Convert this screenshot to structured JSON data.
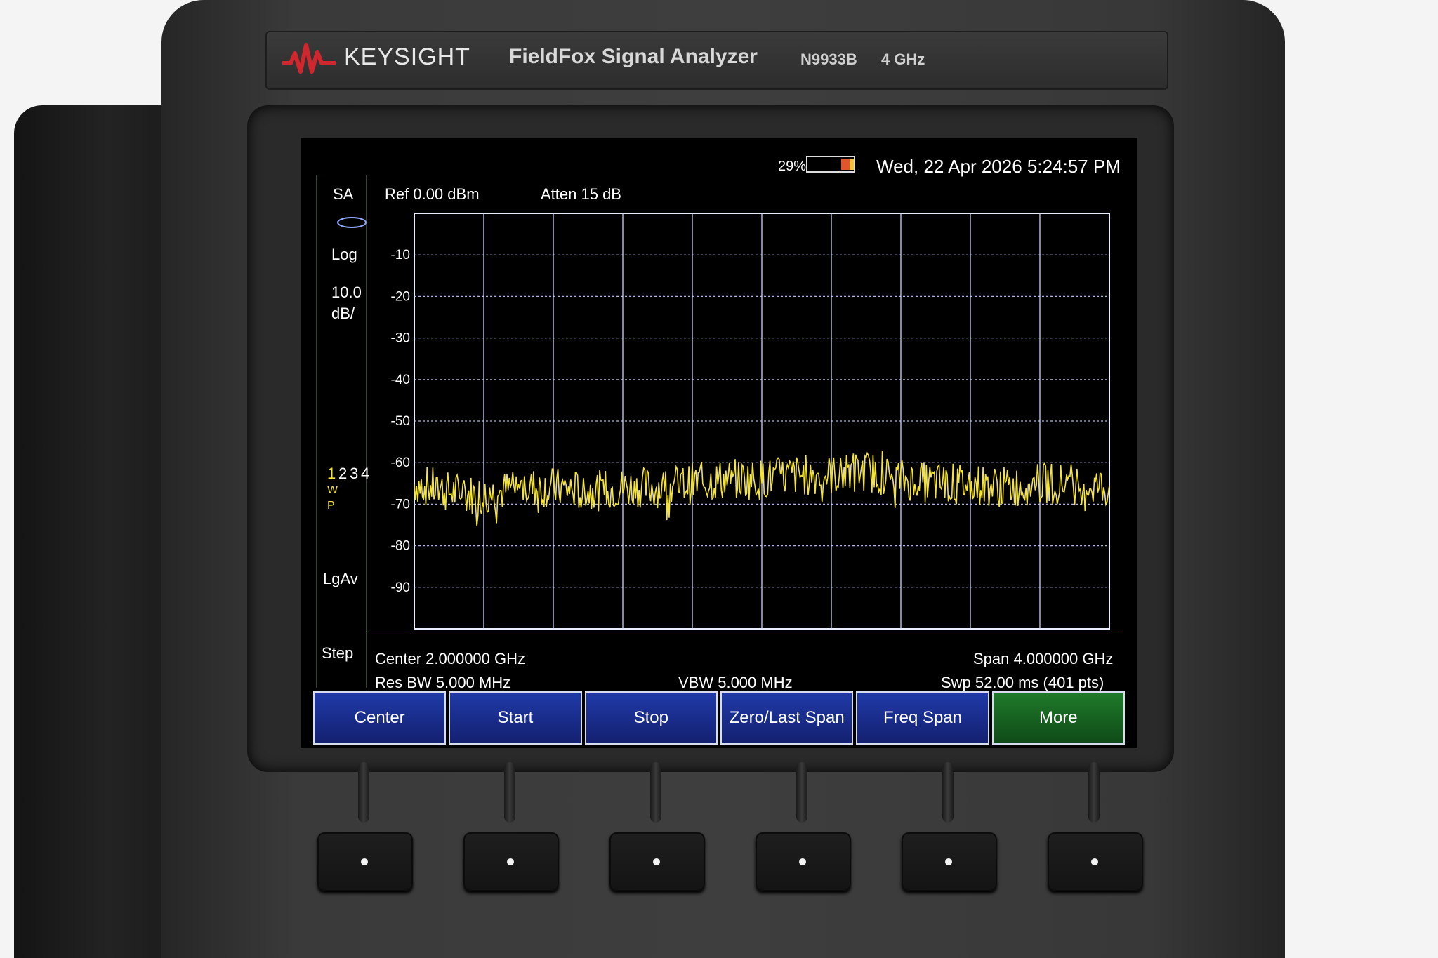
{
  "device": {
    "brand": "KEYSIGHT",
    "model": "FieldFox Signal Analyzer",
    "part_number": "N9933B",
    "frequency": "4 GHz"
  },
  "status_bar": {
    "battery": "29%",
    "datetime": "Wed, 22 Apr 2026 5:24:57 PM"
  },
  "header": {
    "mode": "SA",
    "ref_level": "Ref 0.00 dBm",
    "attenuation": "Atten 15 dB"
  },
  "left_panel": {
    "scale_type": "Log",
    "scale_value": "10.0",
    "scale_unit": "dB/",
    "trace_numbers": [
      "1",
      "2",
      "3",
      "4"
    ],
    "trace_mode_w": "W",
    "trace_mode_p": "P",
    "detector": "LgAv",
    "step": "Step"
  },
  "bottom_panel": {
    "center": "Center 2.000000 GHz",
    "span": "Span 4.000000 GHz",
    "res_bw": "Res BW 5.000 MHz",
    "vbw": "VBW 5.000 MHz",
    "sweep": "Swp 52.00 ms (401 pts)"
  },
  "softkeys": [
    "Center",
    "Start",
    "Stop",
    "Zero/Last Span",
    "Freq Span",
    "More"
  ],
  "colors": {
    "trace": "#f3e33a",
    "grid": "#cfd6ff",
    "softkey_blue": "#1f3aa8",
    "softkey_green": "#1f7a2a",
    "brand_red": "#d0262e"
  },
  "chart_data": {
    "type": "line",
    "title": "",
    "xlabel": "",
    "ylabel": "",
    "y_tick_labels": [
      "-10",
      "-20",
      "-30",
      "-40",
      "-50",
      "-60",
      "-70",
      "-80",
      "-90"
    ],
    "ylim": [
      -100,
      0
    ],
    "xlim": [
      0,
      4
    ],
    "x_unit": "GHz",
    "grid": true,
    "series": [
      {
        "x": [
          0.0,
          0.2,
          0.4,
          0.6,
          0.8,
          1.0,
          1.2,
          1.4,
          1.6,
          1.8,
          2.0,
          2.2,
          2.4,
          2.6,
          2.8,
          3.0,
          3.2,
          3.4,
          3.6,
          3.8,
          4.0
        ],
        "values": [
          -65,
          -67,
          -68,
          -66,
          -66,
          -67,
          -66,
          -66,
          -65,
          -64,
          -64,
          -63,
          -63,
          -62,
          -64,
          -65,
          -65,
          -66,
          -65,
          -65,
          -66
        ]
      }
    ]
  }
}
